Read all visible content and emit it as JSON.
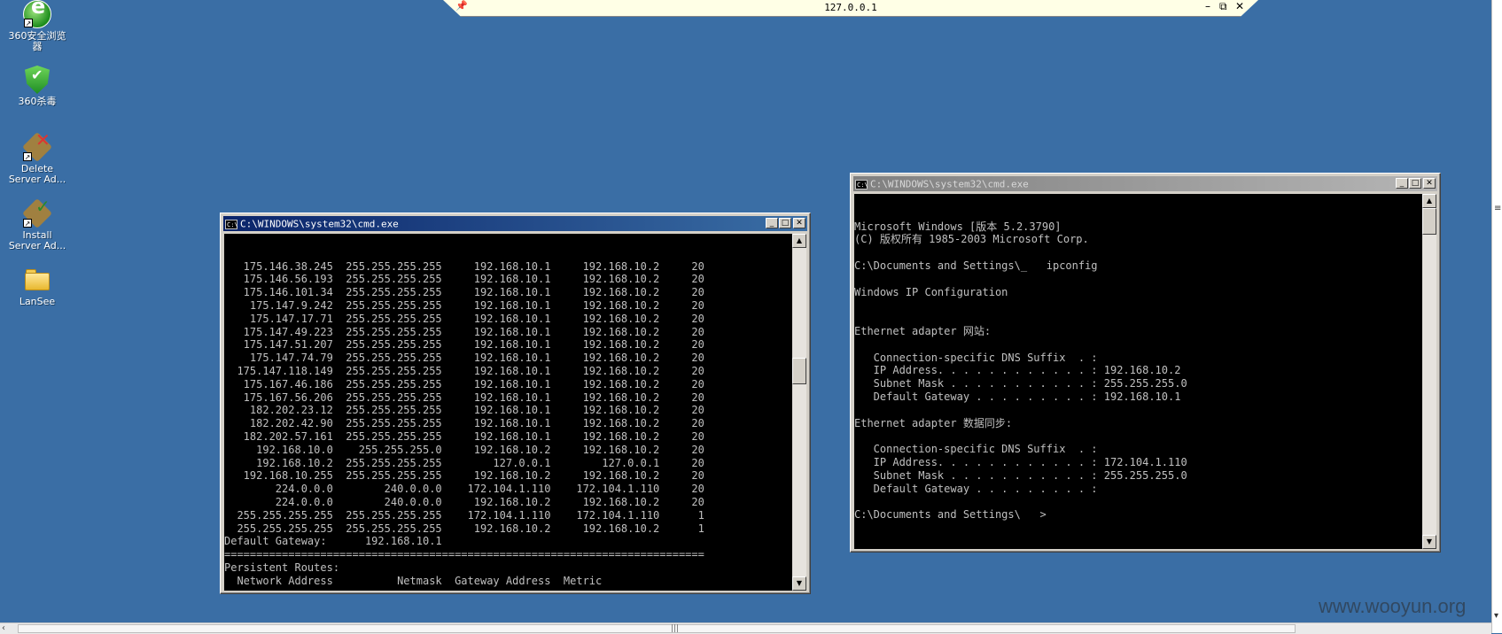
{
  "rdp_bar": {
    "host": "127.0.0.1",
    "pin_icon": "pin-icon",
    "minimize": "–",
    "restore": "⧉",
    "close": "✕"
  },
  "desktop_icons": [
    {
      "label": "360安全浏览器",
      "icon": "browser-icon"
    },
    {
      "label": "360杀毒",
      "icon": "shield-icon"
    },
    {
      "label": "Delete Server Ad...",
      "icon": "tool-icon"
    },
    {
      "label": "Install Server Ad...",
      "icon": "tool-icon"
    },
    {
      "label": "LanSee",
      "icon": "folder-icon"
    }
  ],
  "cmd_left": {
    "title": "C:\\WINDOWS\\system32\\cmd.exe",
    "lines": [
      "   175.146.38.245  255.255.255.255     192.168.10.1     192.168.10.2     20",
      "   175.146.56.193  255.255.255.255     192.168.10.1     192.168.10.2     20",
      "   175.146.101.34  255.255.255.255     192.168.10.1     192.168.10.2     20",
      "    175.147.9.242  255.255.255.255     192.168.10.1     192.168.10.2     20",
      "    175.147.17.71  255.255.255.255     192.168.10.1     192.168.10.2     20",
      "   175.147.49.223  255.255.255.255     192.168.10.1     192.168.10.2     20",
      "   175.147.51.207  255.255.255.255     192.168.10.1     192.168.10.2     20",
      "    175.147.74.79  255.255.255.255     192.168.10.1     192.168.10.2     20",
      "  175.147.118.149  255.255.255.255     192.168.10.1     192.168.10.2     20",
      "   175.167.46.186  255.255.255.255     192.168.10.1     192.168.10.2     20",
      "   175.167.56.206  255.255.255.255     192.168.10.1     192.168.10.2     20",
      "    182.202.23.12  255.255.255.255     192.168.10.1     192.168.10.2     20",
      "    182.202.42.90  255.255.255.255     192.168.10.1     192.168.10.2     20",
      "   182.202.57.161  255.255.255.255     192.168.10.1     192.168.10.2     20",
      "     192.168.10.0    255.255.255.0     192.168.10.2     192.168.10.2     20",
      "     192.168.10.2  255.255.255.255        127.0.0.1        127.0.0.1     20",
      "   192.168.10.255  255.255.255.255     192.168.10.2     192.168.10.2     20",
      "        224.0.0.0        240.0.0.0    172.104.1.110    172.104.1.110     20",
      "        224.0.0.0        240.0.0.0     192.168.10.2     192.168.10.2     20",
      "  255.255.255.255  255.255.255.255    172.104.1.110    172.104.1.110      1",
      "  255.255.255.255  255.255.255.255     192.168.10.2     192.168.10.2      1",
      "Default Gateway:      192.168.10.1",
      "===========================================================================",
      "Persistent Routes:",
      "  Network Address          Netmask  Gateway Address  Metric"
    ]
  },
  "cmd_right": {
    "title": "C:\\WINDOWS\\system32\\cmd.exe",
    "lines": [
      "Microsoft Windows [版本 5.2.3790]",
      "(C) 版权所有 1985-2003 Microsoft Corp.",
      "",
      "C:\\Documents and Settings\\_   ipconfig",
      "",
      "Windows IP Configuration",
      "",
      "",
      "Ethernet adapter 网站:",
      "",
      "   Connection-specific DNS Suffix  . :",
      "   IP Address. . . . . . . . . . . . : 192.168.10.2",
      "   Subnet Mask . . . . . . . . . . . : 255.255.255.0",
      "   Default Gateway . . . . . . . . . : 192.168.10.1",
      "",
      "Ethernet adapter 数据同步:",
      "",
      "   Connection-specific DNS Suffix  . :",
      "   IP Address. . . . . . . . . . . . : 172.104.1.110",
      "   Subnet Mask . . . . . . . . . . . : 255.255.255.0",
      "   Default Gateway . . . . . . . . . :",
      "",
      "C:\\Documents and Settings\\   >"
    ]
  },
  "watermark": "www.wooyun.org",
  "window_buttons": {
    "minimize": "_",
    "maximize": "□",
    "close": "✕"
  },
  "colors": {
    "desktop": "#3a6ea5",
    "active_title": "#0a246a",
    "console_text": "#c0c0c0"
  }
}
